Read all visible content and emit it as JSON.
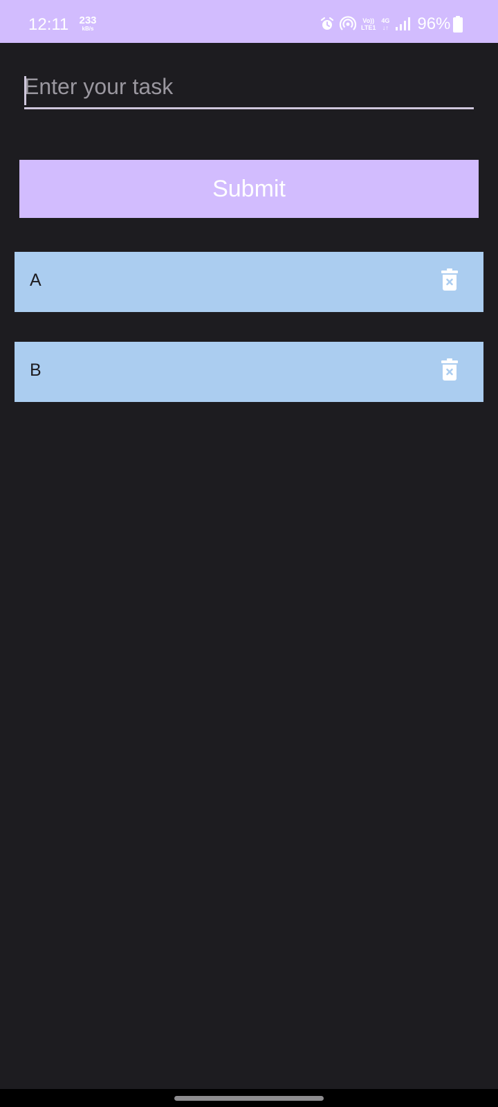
{
  "status_bar": {
    "time": "12:11",
    "net_speed_value": "233",
    "net_speed_unit": "kB/s",
    "volte_top": "Vo))",
    "volte_bottom": "LTE1",
    "network_type": "4G",
    "network_arrows": "↓↑",
    "battery_percent": "96%",
    "icons": [
      "alarm-icon",
      "hotspot-icon",
      "signal-icon",
      "battery-icon"
    ]
  },
  "task_input": {
    "placeholder": "Enter your task",
    "value": ""
  },
  "submit": {
    "label": "Submit"
  },
  "tasks": [
    {
      "label": "A",
      "icon": "delete-icon"
    },
    {
      "label": "B",
      "icon": "delete-icon"
    }
  ],
  "colors": {
    "accent": "#d2bcfe",
    "background": "#1d1c20",
    "task_card": "#abcdf0",
    "nav_bar": "#000000"
  }
}
